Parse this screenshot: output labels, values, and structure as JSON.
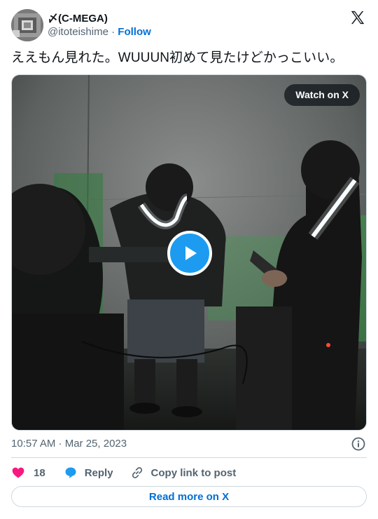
{
  "author": {
    "display_name": "〆(C-MEGA)",
    "handle": "@itoteishime",
    "separator": " · ",
    "follow_label": "Follow"
  },
  "tweet": {
    "text": "ええもん見れた。WUUUN初めて見たけどかっこいい。"
  },
  "media": {
    "watch_label": "Watch on X"
  },
  "meta": {
    "timestamp": "10:57 AM · Mar 25, 2023"
  },
  "actions": {
    "like_count": "18",
    "reply_label": "Reply",
    "copy_label": "Copy link to post"
  },
  "footer": {
    "read_more_label": "Read more on X"
  },
  "colors": {
    "accent_blue": "#1d9bf0",
    "link_blue": "#006fd6",
    "like_pink": "#f91880",
    "muted_gray": "#536471"
  },
  "icons": {
    "logo": "x-logo-icon",
    "like": "heart-icon",
    "reply": "speech-bubble-icon",
    "copy": "link-icon",
    "info": "info-icon",
    "play": "play-icon"
  }
}
